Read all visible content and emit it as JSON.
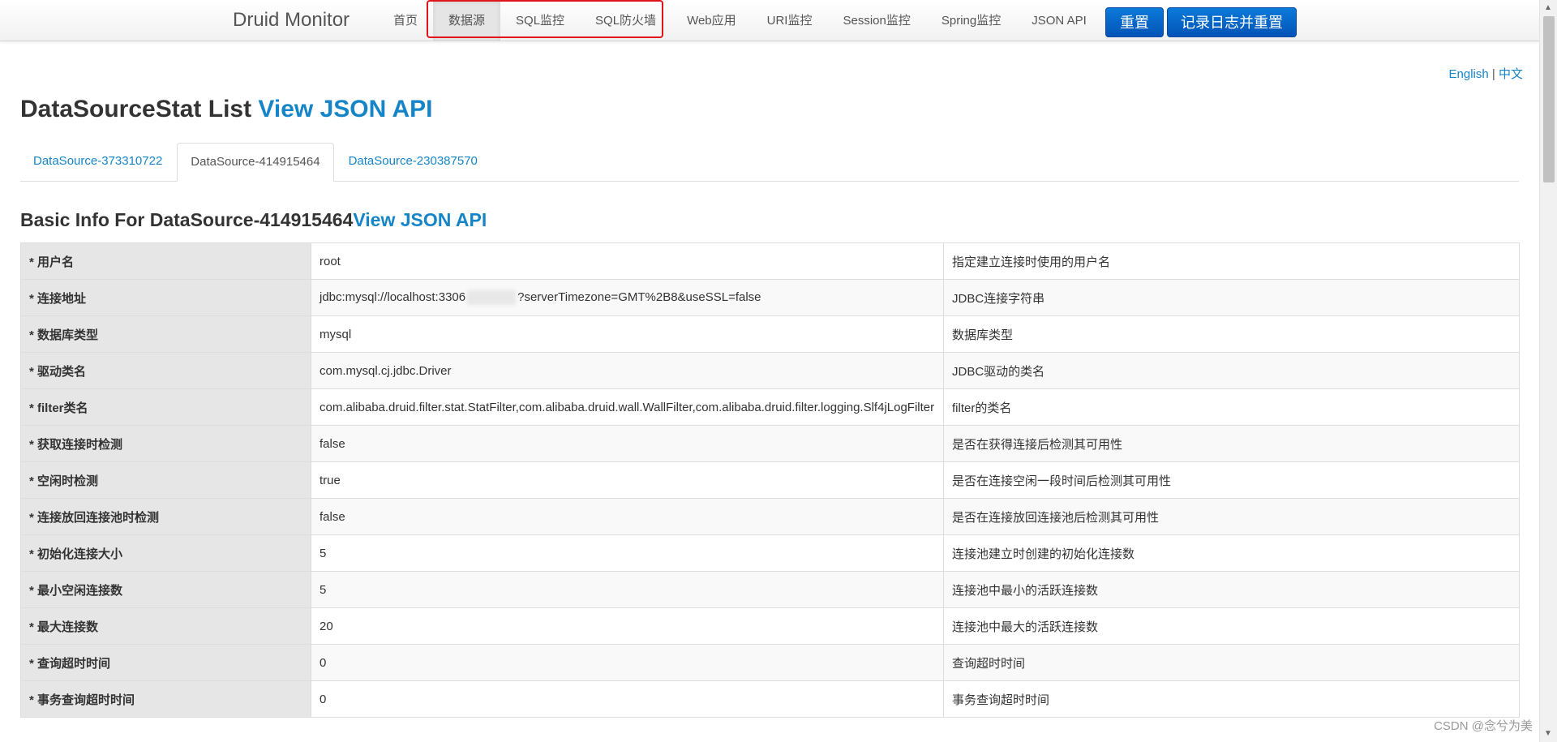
{
  "brand": "Druid Monitor",
  "nav": [
    "首页",
    "数据源",
    "SQL监控",
    "SQL防火墙",
    "Web应用",
    "URI监控",
    "Session监控",
    "Spring监控",
    "JSON API"
  ],
  "buttons": {
    "reset": "重置",
    "log_reset": "记录日志并重置"
  },
  "lang": {
    "english": "English",
    "sep": "|",
    "chinese": "中文"
  },
  "page_title": {
    "text": "DataSourceStat List ",
    "link": "View JSON API"
  },
  "tabs": [
    "DataSource-373310722",
    "DataSource-414915464",
    "DataSource-230387570"
  ],
  "section": {
    "text": "Basic Info For DataSource-414915464",
    "link": "View JSON API"
  },
  "rows": [
    {
      "key": "* 用户名",
      "val": "root",
      "desc": "指定建立连接时使用的用户名"
    },
    {
      "key": "* 连接地址",
      "val_prefix": "jdbc:mysql://localhost:3306",
      "val_suffix": "?serverTimezone=GMT%2B8&useSSL=false",
      "desc": "JDBC连接字符串"
    },
    {
      "key": "* 数据库类型",
      "val": "mysql",
      "desc": "数据库类型"
    },
    {
      "key": "* 驱动类名",
      "val": "com.mysql.cj.jdbc.Driver",
      "desc": "JDBC驱动的类名"
    },
    {
      "key": "* filter类名",
      "val": "com.alibaba.druid.filter.stat.StatFilter,com.alibaba.druid.wall.WallFilter,com.alibaba.druid.filter.logging.Slf4jLogFilter",
      "desc": "filter的类名"
    },
    {
      "key": "* 获取连接时检测",
      "val": "false",
      "desc": "是否在获得连接后检测其可用性"
    },
    {
      "key": "* 空闲时检测",
      "val": "true",
      "desc": "是否在连接空闲一段时间后检测其可用性"
    },
    {
      "key": "* 连接放回连接池时检测",
      "val": "false",
      "desc": "是否在连接放回连接池后检测其可用性"
    },
    {
      "key": "* 初始化连接大小",
      "val": "5",
      "desc": "连接池建立时创建的初始化连接数"
    },
    {
      "key": "* 最小空闲连接数",
      "val": "5",
      "desc": "连接池中最小的活跃连接数"
    },
    {
      "key": "* 最大连接数",
      "val": "20",
      "desc": "连接池中最大的活跃连接数"
    },
    {
      "key": "* 查询超时时间",
      "val": "0",
      "desc": "查询超时时间"
    },
    {
      "key": "* 事务查询超时时间",
      "val": "0",
      "desc": "事务查询超时时间"
    }
  ],
  "watermark": "CSDN @念兮为美",
  "colors": {
    "link": "#1685c8",
    "button": "#0a68c8",
    "highlight": "#e0151b"
  }
}
